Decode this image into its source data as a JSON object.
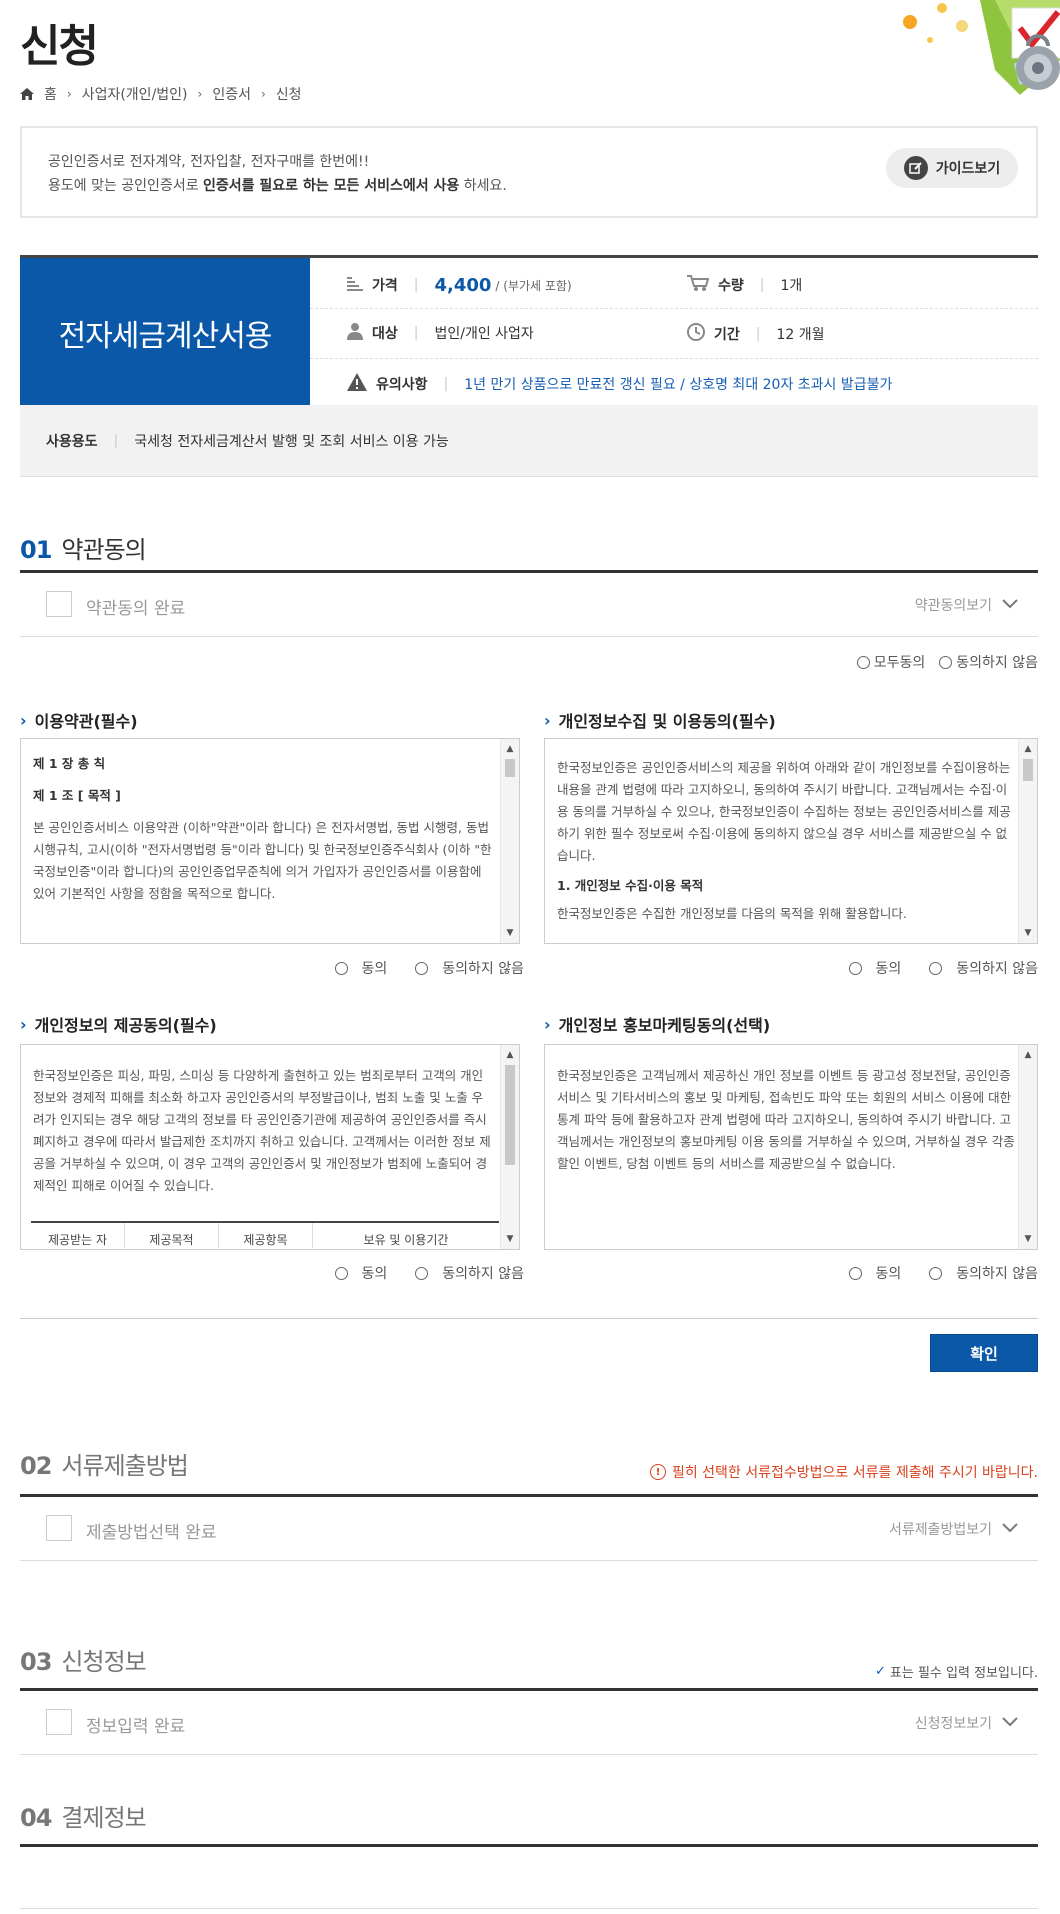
{
  "page": {
    "title": "신청"
  },
  "breadcrumb": {
    "items": [
      "홈",
      "사업자(개인/법인)",
      "인증서",
      "신청"
    ]
  },
  "intro": {
    "line1": "공인인증서로 전자계약, 전자입찰, 전자구매를 한번에!!",
    "line2_prefix": "용도에 맞는 공인인증서로 ",
    "line2_bold": "인증서를 필요로 하는 모든 서비스에서 사용",
    "line2_suffix": " 하세요.",
    "guide_button": "가이드보기"
  },
  "product": {
    "name": "전자세금계산서용",
    "price_label": "가격",
    "price": "4,400",
    "price_vat": "/ (부가세 포함)",
    "qty_label": "수량",
    "qty": "1개",
    "target_label": "대상",
    "target": "법인/개인 사업자",
    "period_label": "기간",
    "period": "12 개월",
    "notice_label": "유의사항",
    "notice": "1년 만기 상품으로 만료전 갱신 필요 / 상호명 최대 20자 초과시 발급불가",
    "usage_label": "사용용도",
    "usage": "국세청 전자세금계산서 발행 및 조회 서비스 이용 가능"
  },
  "section1": {
    "num": "01",
    "title": "약관동의",
    "checkbox_label": "약관동의 완료",
    "toggle": "약관동의보기",
    "agree_all": "모두동의",
    "disagree_all": "동의하지 않음",
    "terms": [
      {
        "title": "이용약관(필수)",
        "heading1": "제 1 장 총 칙",
        "heading2": "제 1 조 [ 목적 ]",
        "body": "본 공인인증서비스 이용약관 (이하\"약관\"이라 합니다) 은 전자서명법, 동법 시행령, 동법 시행규칙, 고시(이하 \"전자서명법령 등\"이라 합니다) 및 한국정보인증주식회사 (이하 \"한국정보인증\"이라 합니다)의 공인인증업무준칙에 의거 가입자가 공인인증서를 이용함에 있어 기본적인 사항을 정함을 목적으로 합니다.",
        "agree": "동의",
        "disagree": "동의하지 않음"
      },
      {
        "title": "개인정보수집 및 이용동의(필수)",
        "body": "한국정보인증은 공인인증서비스의 제공을 위하여 아래와 같이 개인정보를 수집이용하는 내용을 관계 법령에 따라 고지하오니, 동의하여 주시기 바랍니다. 고객님께서는 수집·이용 동의를 거부하실 수 있으나, 한국정보인증이 수집하는 정보는 공인인증서비스를 제공하기 위한 필수 정보로써 수집·이용에 동의하지 않으실 경우 서비스를 제공받으실 수 없습니다.",
        "heading": "1. 개인정보 수집·이용 목적",
        "body2": "한국정보인증은 수집한 개인정보를 다음의 목적을 위해 활용합니다.",
        "agree": "동의",
        "disagree": "동의하지 않음"
      },
      {
        "title": "개인정보의 제공동의(필수)",
        "body": "한국정보인증은 피싱, 파밍, 스미싱 등 다양하게 출현하고 있는 범죄로부터 고객의 개인정보와 경제적 피해를 최소화 하고자 공인인증서의 부정발급이나, 범죄 노출 및 노출 우려가 인지되는 경우 해당 고객의 정보를 타 공인인증기관에 제공하여 공인인증서를 즉시 폐지하고 경우에 따라서 발급제한 조치까지 취하고 있습니다. 고객께서는 이러한 정보 제공을 거부하실 수 있으며, 이 경우 고객의 공인인증서 및 개인정보가 범죄에 노출되어 경제적인 피해로 이어질 수 있습니다.",
        "table_headers": [
          "제공받는 자",
          "제공목적",
          "제공항목",
          "보유 및 이용기간"
        ],
        "agree": "동의",
        "disagree": "동의하지 않음"
      },
      {
        "title": "개인정보 홍보마케팅동의(선택)",
        "body": "한국정보인증은 고객님께서 제공하신 개인 정보를 이벤트 등 광고성 정보전달, 공인인증서비스 및 기타서비스의 홍보 및 마케팅, 접속빈도 파악 또는 회원의 서비스 이용에 대한 통계 파악 등에 활용하고자 관계 법령에 따라 고지하오니, 동의하여 주시기 바랍니다. 고객님께서는 개인정보의 홍보마케팅 이용 동의를 거부하실 수 있으며, 거부하실 경우 각종 할인 이벤트, 당첨 이벤트 등의 서비스를 제공받으실 수 없습니다.",
        "agree": "동의",
        "disagree": "동의하지 않음"
      }
    ],
    "confirm": "확인"
  },
  "section2": {
    "num": "02",
    "title": "서류제출방법",
    "warning": "필히 선택한 서류접수방법으로 서류를 제출해 주시기 바랍니다.",
    "checkbox_label": "제출방법선택 완료",
    "toggle": "서류제출방법보기"
  },
  "section3": {
    "num": "03",
    "title": "신청정보",
    "required_note": "표는 필수 입력 정보입니다.",
    "checkbox_label": "정보입력 완료",
    "toggle": "신청정보보기"
  },
  "section4": {
    "num": "04",
    "title": "결제정보"
  },
  "colors": {
    "primary": "#0b58a8",
    "warning": "#d9411e",
    "product_bg": "#0b58a8"
  }
}
